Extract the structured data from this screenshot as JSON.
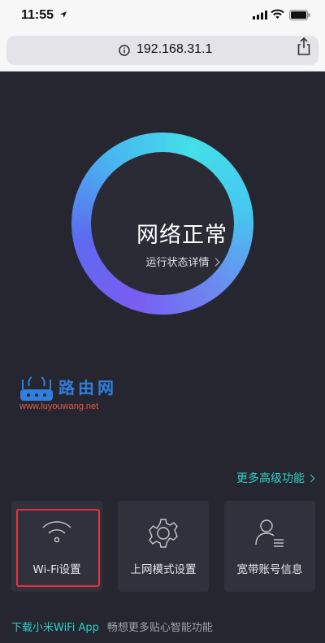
{
  "status_bar": {
    "time": "11:55"
  },
  "browser": {
    "url": "192.168.31.1"
  },
  "main": {
    "status_title": "网络正常",
    "status_link": "运行状态详情",
    "watermark_text": "路由网",
    "watermark_url": "www.luyouwang.net",
    "more_features": "更多高级功能"
  },
  "tiles": [
    {
      "label": "Wi-Fi设置",
      "icon": "wifi-icon"
    },
    {
      "label": "上网模式设置",
      "icon": "gear-icon"
    },
    {
      "label": "宽带账号信息",
      "icon": "user-account-icon"
    }
  ],
  "footer": {
    "download": "下载小米WiFi App",
    "description": "畅想更多贴心智能功能"
  },
  "colors": {
    "background": "#25262f",
    "accent": "#2fd0c6",
    "highlight": "#e5323f",
    "ring_start": "#43dfe9",
    "ring_end": "#7a5cf2"
  }
}
